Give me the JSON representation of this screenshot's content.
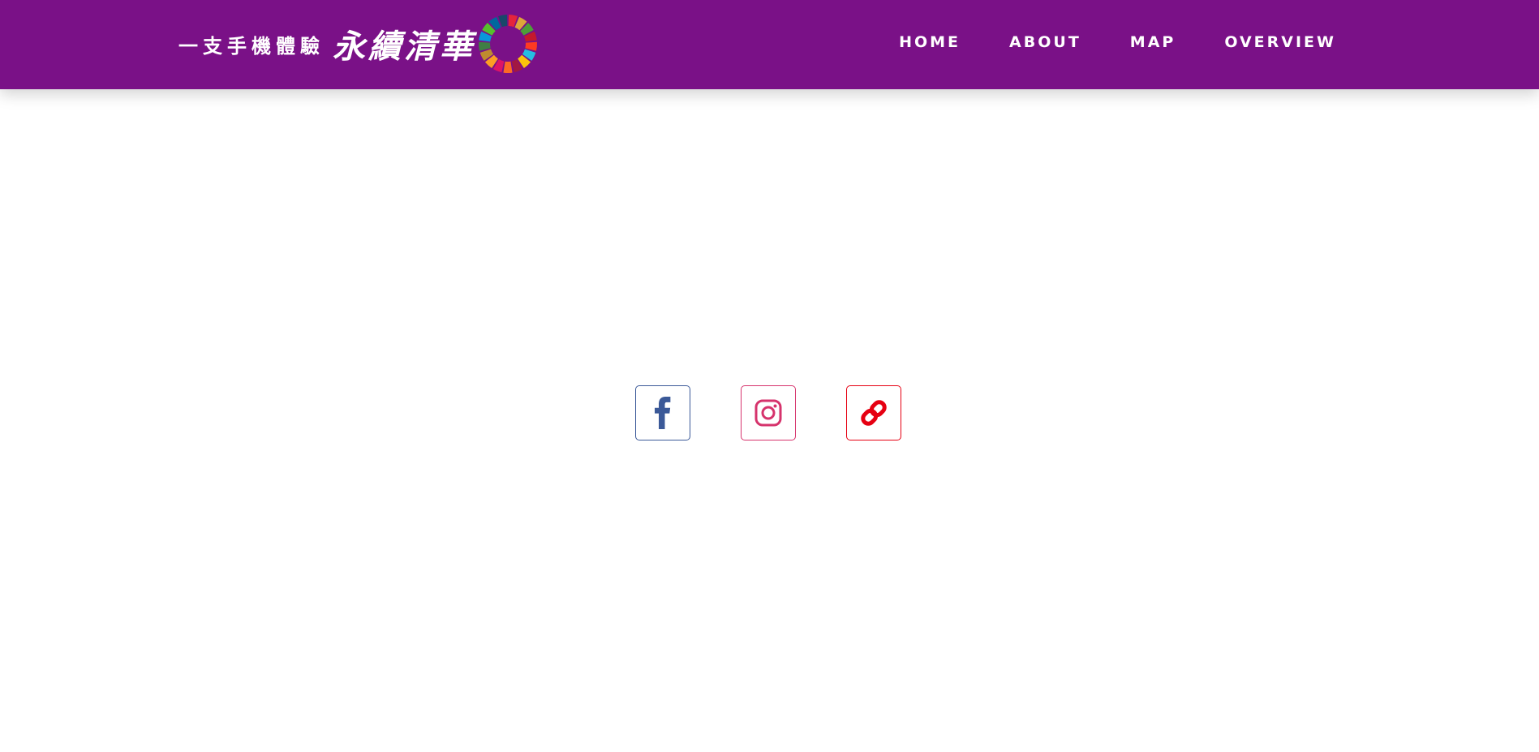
{
  "header": {
    "logo_subtitle": "一支手機體驗",
    "logo_title": "永續清華",
    "background_color": "#7a1187"
  },
  "nav": {
    "items": [
      {
        "label": "HOME"
      },
      {
        "label": "ABOUT"
      },
      {
        "label": "MAP"
      },
      {
        "label": "OVERVIEW"
      }
    ]
  },
  "social": {
    "buttons": [
      {
        "icon": "facebook-icon",
        "color": "#3b5998"
      },
      {
        "icon": "instagram-icon",
        "color": "#d6336c"
      },
      {
        "icon": "link-icon",
        "color": "#e60012"
      }
    ]
  }
}
